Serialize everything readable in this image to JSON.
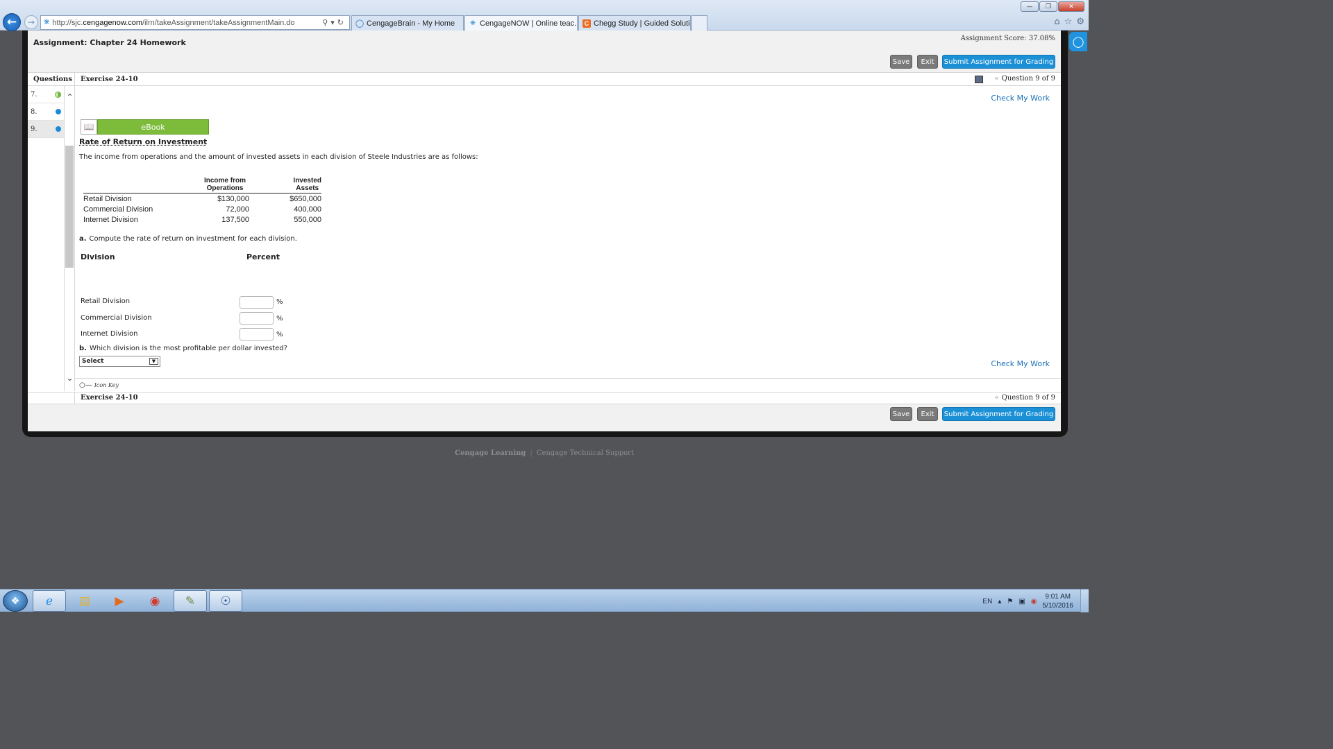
{
  "browser": {
    "url_prefix": "http://sjc.",
    "url_domain": "cengagenow.com",
    "url_path": "/ilrn/takeAssignment/takeAssignmentMain.do",
    "tabs": [
      {
        "label": "CengageBrain - My Home",
        "icon": "ie-icon",
        "active": false
      },
      {
        "label": "CengageNOW | Online teac...",
        "icon": "cengage-icon",
        "active": true
      },
      {
        "label": "Chegg Study | Guided Solutio...",
        "icon": "chegg-icon",
        "active": false
      }
    ]
  },
  "header": {
    "title": "Assignment: Chapter 24 Homework",
    "score": "Assignment Score: 37.08%",
    "save_label": "Save",
    "exit_label": "Exit",
    "submit_label": "Submit Assignment for Grading"
  },
  "questions_panel": {
    "heading": "Questions",
    "items": [
      {
        "number": "7.",
        "status": "partial"
      },
      {
        "number": "8.",
        "status": "unanswered"
      },
      {
        "number": "9.",
        "status": "unanswered",
        "selected": true
      }
    ]
  },
  "exercise": {
    "title": "Exercise 24-10",
    "question_counter": "Question 9 of 9",
    "check_my_work": "Check My Work",
    "ebook_label": "eBook",
    "section_title": "Rate of Return on Investment",
    "intro": "The income from operations and the amount of invested assets in each division of Steele Industries are as follows:",
    "table": {
      "headers": [
        "",
        "Income from Operations",
        "Invested Assets"
      ],
      "header_lines": [
        [
          "Income from",
          "Operations"
        ],
        [
          "Invested",
          "Assets"
        ]
      ],
      "rows": [
        {
          "division": "Retail Division",
          "income": "$130,000",
          "assets": "$650,000"
        },
        {
          "division": "Commercial Division",
          "income": "72,000",
          "assets": "400,000"
        },
        {
          "division": "Internet Division",
          "income": "137,500",
          "assets": "550,000"
        }
      ]
    },
    "part_a": {
      "letter": "a.",
      "text": "Compute the rate of return on investment for each division."
    },
    "answer_table": {
      "division_header": "Division",
      "percent_header": "Percent",
      "rows": [
        {
          "division": "Retail Division",
          "value": "",
          "unit": "%"
        },
        {
          "division": "Commercial Division",
          "value": "",
          "unit": "%"
        },
        {
          "division": "Internet Division",
          "value": "",
          "unit": "%"
        }
      ]
    },
    "part_b": {
      "letter": "b.",
      "text": "Which division is the most profitable per dollar invested?",
      "select_value": "Select"
    },
    "icon_key": "Icon Key"
  },
  "page_footer": {
    "left_link": "Cengage Learning",
    "right_link": "Cengage Technical Support"
  },
  "taskbar": {
    "language": "EN",
    "time": "9:01 AM",
    "date": "5/10/2016"
  }
}
